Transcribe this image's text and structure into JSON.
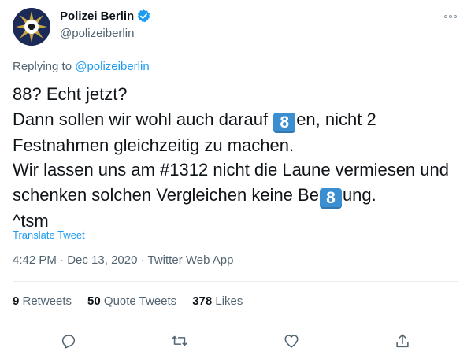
{
  "author": {
    "display_name": "Polizei Berlin",
    "handle": "@polizeiberlin",
    "verified_icon": "verified-badge-icon",
    "avatar_icon": "police-star-bear-emblem"
  },
  "reply": {
    "prefix": "Replying to ",
    "to": "@polizeiberlin"
  },
  "body": {
    "line1": "88? Echt jetzt?",
    "line2_a": "Dann sollen wir wohl auch darauf ",
    "line2_key": "8",
    "line2_b": "en, nicht 2",
    "line3": "Festnahmen gleichzeitig zu machen.",
    "line4": "Wir lassen uns am #1312 nicht die Laune vermiesen und",
    "line5_a": "schenken solchen Vergleichen keine Be",
    "line5_key": "8",
    "line5_b": "ung.",
    "line6": "^tsm"
  },
  "translate_label": "Translate Tweet",
  "meta": {
    "time": "4:42 PM",
    "sep1": " · ",
    "date": "Dec 13, 2020",
    "sep2": " · ",
    "source": "Twitter Web App"
  },
  "stats": {
    "retweets_count": "9",
    "retweets_label": " Retweets",
    "quotes_count": "50",
    "quotes_label": " Quote Tweets",
    "likes_count": "378",
    "likes_label": " Likes"
  },
  "actions": [
    "reply-icon",
    "retweet-icon",
    "like-icon",
    "share-icon"
  ],
  "colors": {
    "link": "#1d9bf0",
    "secondary_text": "#536471",
    "keycap_blue": "#3b8ed0",
    "avatar_navy": "#1b2a57",
    "avatar_gold": "#c9a640"
  }
}
